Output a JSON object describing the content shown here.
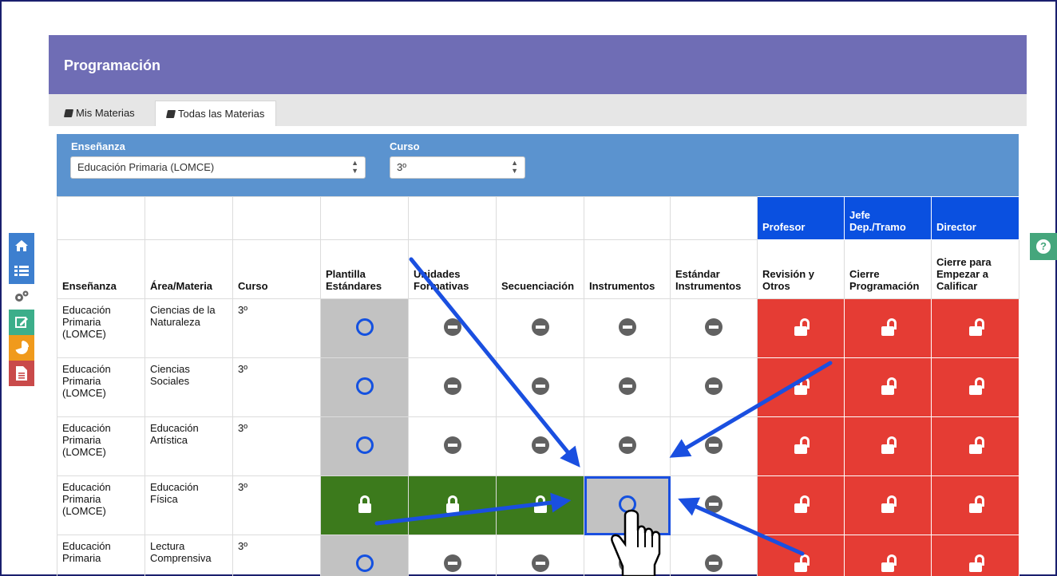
{
  "header": {
    "title": "Programación"
  },
  "tabs": [
    {
      "label": "Mis Materias",
      "icon": "book-icon",
      "active": false
    },
    {
      "label": "Todas las Materias",
      "icon": "book-icon",
      "active": true
    }
  ],
  "filters": {
    "ensenanza": {
      "label": "Enseñanza",
      "value": "Educación Primaria (LOMCE)"
    },
    "curso": {
      "label": "Curso",
      "value": "3º"
    }
  },
  "roles": {
    "profesor": "Profesor",
    "jefe": "Jefe Dep./Tramo",
    "director": "Director"
  },
  "columns": [
    "Enseñanza",
    "Área/Materia",
    "Curso",
    "Plantilla Estándares",
    "Unidades Formativas",
    "Secuenciación",
    "Instrumentos",
    "Estándar Instrumentos",
    "Revisión y Otros",
    "Cierre Programación",
    "Cierre para Empezar a Calificar"
  ],
  "rows": [
    {
      "ensenanza": "Educación Primaria (LOMCE)",
      "area": "Ciencias de la Naturaleza",
      "curso": "3º"
    },
    {
      "ensenanza": "Educación Primaria (LOMCE)",
      "area": "Ciencias Sociales",
      "curso": "3º"
    },
    {
      "ensenanza": "Educación Primaria (LOMCE)",
      "area": "Educación Artística",
      "curso": "3º"
    },
    {
      "ensenanza": "Educación Primaria (LOMCE)",
      "area": "Educación Física",
      "curso": "3º"
    },
    {
      "ensenanza": "Educación Primaria",
      "area": "Lectura Comprensiva",
      "curso": "3º"
    }
  ],
  "sidebar": [
    "home-icon",
    "list-icon",
    "gears-icon",
    "edit-icon",
    "pie-chart-icon",
    "document-icon"
  ],
  "colors": {
    "header": "#6f6db5",
    "filter": "#5b93cf",
    "role": "#0a50e0",
    "locked_green": "#3c7a1c",
    "open_red": "#e53c34",
    "pending_gray": "#c2c2c2",
    "arrow": "#1a4fe0"
  }
}
